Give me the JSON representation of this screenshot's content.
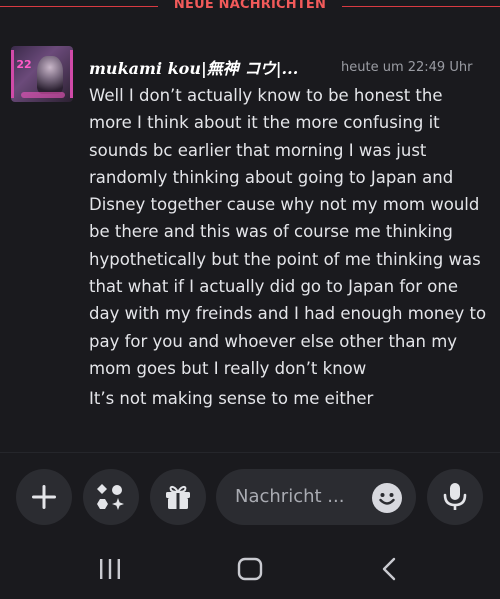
{
  "divider": {
    "label": "NEUE NACHRICHTEN",
    "color": "#f25a5a"
  },
  "message": {
    "username": "mukami kou|無神 コウ|...",
    "timestamp": "heute um 22:49 Uhr",
    "avatar_badge": "22",
    "paragraphs": [
      "Well I don’t actually know to be honest the more I think about it the more confusing it sounds bc earlier that morning I was just randomly thinking about going to Japan and Disney together  cause why not my mom would be there and this was of course me thinking hypothetically but the point of me thinking was that what if I actually did go to Japan for one day with my freinds and I had enough money to pay for you and whoever else other than my mom goes but I really don’t know",
      "It’s not making sense to me either"
    ]
  },
  "composer": {
    "placeholder": "Nachricht ...",
    "icons": [
      "plus-icon",
      "apps-icon",
      "gift-icon",
      "emoji-icon",
      "microphone-icon"
    ]
  },
  "navbar": {
    "icons": [
      "recents-icon",
      "home-icon",
      "back-icon"
    ]
  },
  "colors": {
    "background": "#1a1a1e",
    "button_bg": "#2b2c31",
    "accent_red": "#d83a42"
  }
}
